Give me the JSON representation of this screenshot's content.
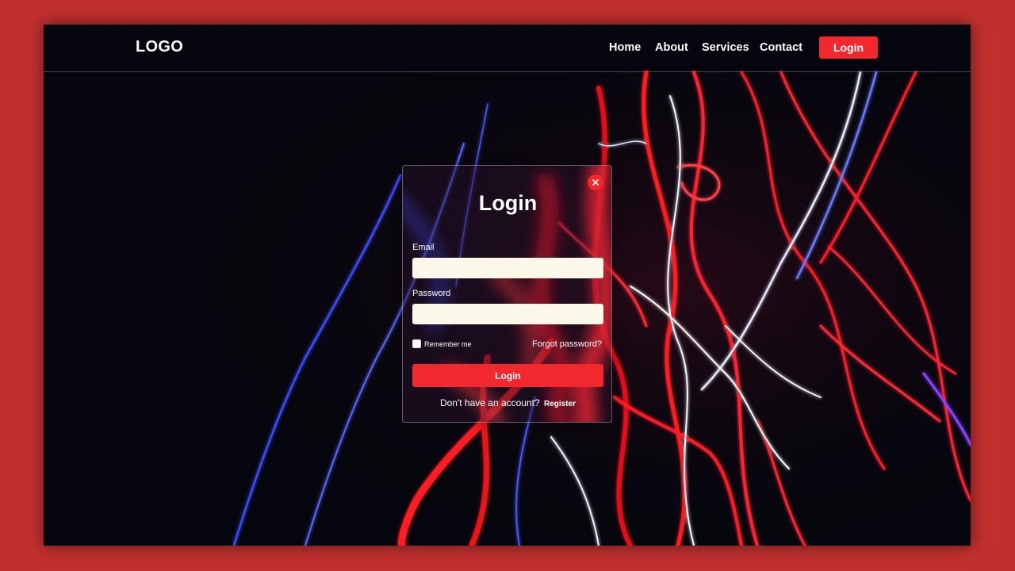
{
  "nav": {
    "logo": "LOGO",
    "links": [
      "Home",
      "About",
      "Services",
      "Contact"
    ],
    "login_button": "Login"
  },
  "modal": {
    "title": "Login",
    "email_label": "Email",
    "email_value": "",
    "password_label": "Password",
    "password_value": "",
    "remember_label": "Remember me",
    "remember_checked": false,
    "forgot_label": "Forgot password?",
    "submit_label": "Login",
    "signup_prompt": "Don't have an account?",
    "register_label": "Register",
    "close_icon": "close-icon"
  },
  "colors": {
    "page_border": "#c0302f",
    "background": "#05060d",
    "accent": "#f2282d",
    "input_bg": "#fbf8e9"
  }
}
